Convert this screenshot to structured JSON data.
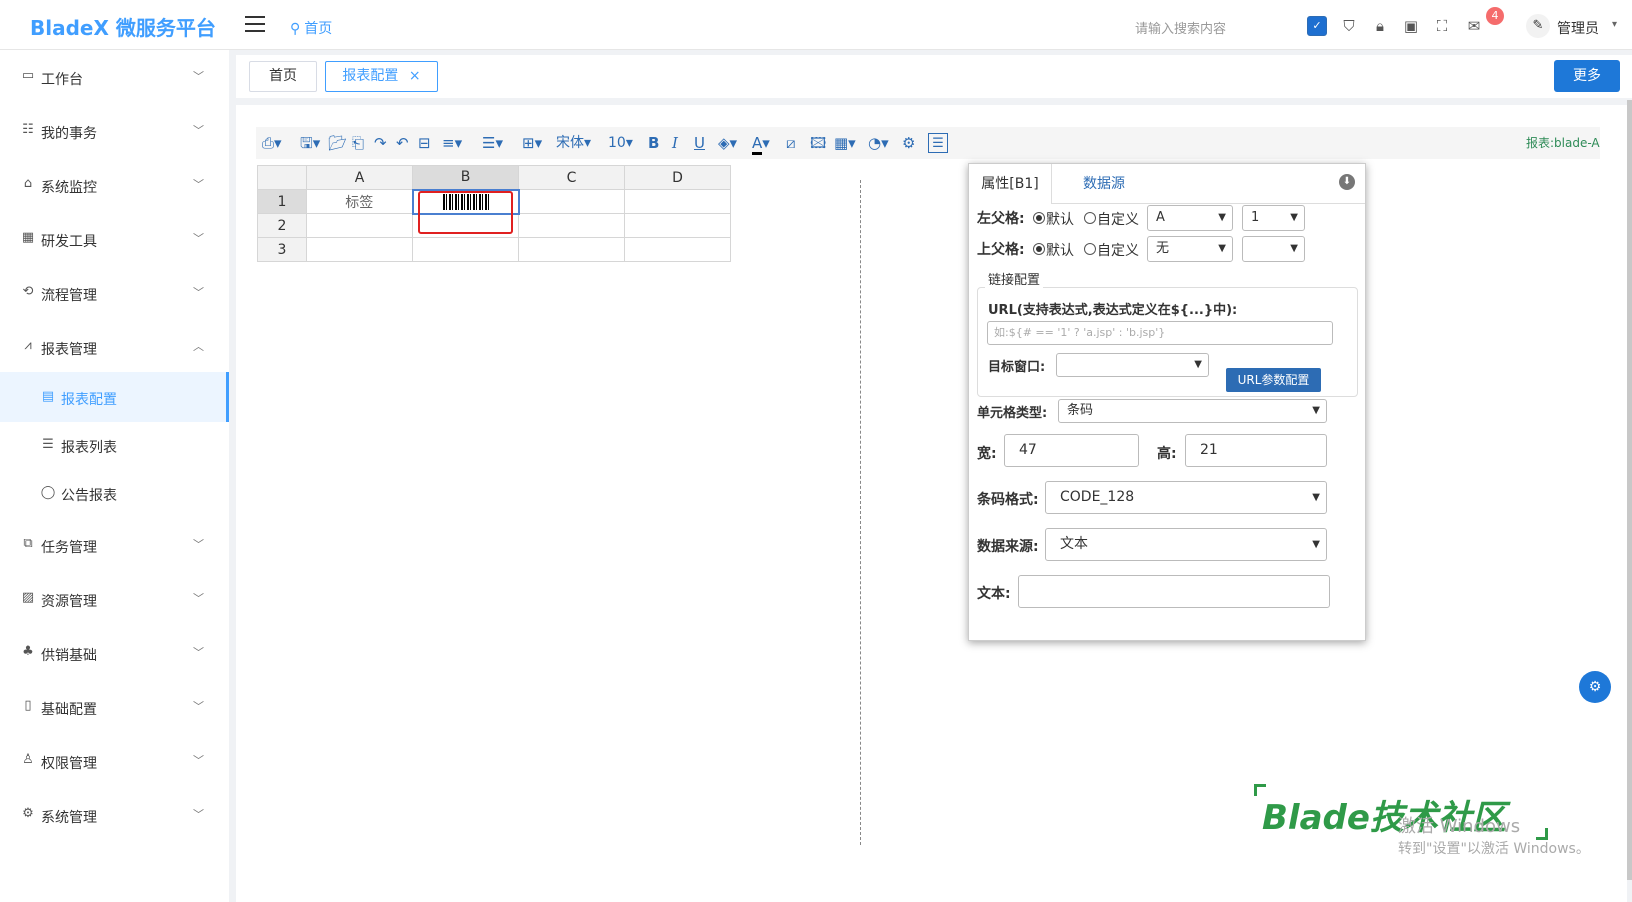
{
  "header": {
    "logo": "BladeX 微服务平台",
    "home_crumb": "首页",
    "search_placeholder": "请输入搜索内容",
    "badge_count": "4",
    "user_name": "管理员"
  },
  "sidebar": {
    "items": [
      {
        "label": "工作台",
        "icon": "monitor-icon"
      },
      {
        "label": "我的事务",
        "icon": "tasks-icon"
      },
      {
        "label": "系统监控",
        "icon": "bank-icon"
      },
      {
        "label": "研发工具",
        "icon": "calendar-icon"
      },
      {
        "label": "流程管理",
        "icon": "flow-icon"
      },
      {
        "label": "报表管理",
        "icon": "chart-icon"
      },
      {
        "label": "任务管理",
        "icon": "copy-icon"
      },
      {
        "label": "资源管理",
        "icon": "image-icon"
      },
      {
        "label": "供销基础",
        "icon": "org-icon"
      },
      {
        "label": "基础配置",
        "icon": "book-icon"
      },
      {
        "label": "权限管理",
        "icon": "user-icon"
      },
      {
        "label": "系统管理",
        "icon": "gear-icon"
      }
    ],
    "sub_items": [
      {
        "label": "报表配置",
        "icon": "document-icon"
      },
      {
        "label": "报表列表",
        "icon": "list-icon"
      },
      {
        "label": "公告报表",
        "icon": "comment-icon"
      }
    ]
  },
  "tabs": {
    "home": "首页",
    "active": "报表配置",
    "close": "×",
    "more": "更多"
  },
  "toolbar": {
    "font": "宋体",
    "size": "10",
    "report_name": "报表:blade-A"
  },
  "grid": {
    "columns": [
      "A",
      "B",
      "C",
      "D"
    ],
    "rows": [
      "1",
      "2",
      "3"
    ],
    "a1": "标签"
  },
  "panel": {
    "tab_props": "属性[B1]",
    "tab_datasource": "数据源",
    "left_parent_label": "左父格:",
    "top_parent_label": "上父格:",
    "default_label": "默认",
    "custom_label": "自定义",
    "left_sel1": "A",
    "left_sel2": "1",
    "top_sel1": "无",
    "top_sel2": "",
    "link_legend": "链接配置",
    "url_label": "URL(支持表达式,表达式定义在${...}中):",
    "url_placeholder": "如:${# == '1' ? 'a.jsp' : 'b.jsp'}",
    "target_label": "目标窗口:",
    "target_value": "",
    "url_param_btn": "URL参数配置",
    "cell_type_label": "单元格类型:",
    "cell_type": "条码",
    "width_label": "宽:",
    "width": "47",
    "height_label": "高:",
    "height": "21",
    "barcode_fmt_label": "条码格式:",
    "barcode_fmt": "CODE_128",
    "datasource_label": "数据来源:",
    "datasource": "文本",
    "text_label": "文本:",
    "text": ""
  },
  "watermark": {
    "brand": "Blade技术社区",
    "activate": "激活 Windows",
    "activate_hint": "转到\"设置\"以激活 Windows。"
  }
}
